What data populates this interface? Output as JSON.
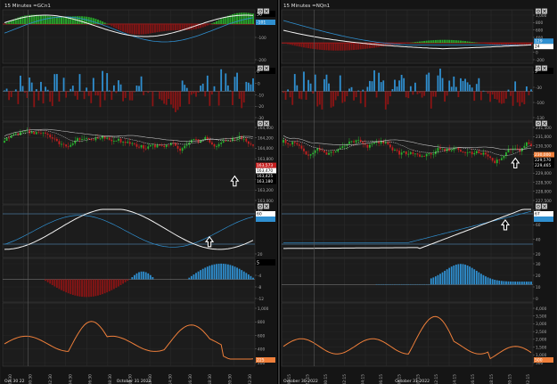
{
  "colors": {
    "bg": "#1c1c1c",
    "grid": "#2c2c2c",
    "up": "#29b32e",
    "down": "#c62020",
    "blue": "#2f8fd0",
    "darkred": "#8b1414",
    "orange": "#ef7f3a",
    "white": "#f2f2f2",
    "sep": "#8a8a8a"
  },
  "left_chart": {
    "title": "15 Minutes =GCn1",
    "panels": [
      {
        "flag": "50",
        "labels": [
          "0",
          "-100",
          "-200"
        ],
        "value_badge": "-101",
        "fills": [
          "hist-top",
          "lines-osc"
        ]
      },
      {
        "flag": "0",
        "labels": [
          "10",
          "0",
          "-10",
          "-20",
          "-30"
        ]
      },
      {
        "flag": "",
        "labels": [
          "164,400",
          "164,200",
          "164,000",
          "163,800",
          "163,600",
          "163,400",
          "163,200",
          "163,000"
        ],
        "price_badges": [
          "163,573",
          "163,470",
          "163,425",
          "163,180"
        ]
      },
      {
        "flag": "",
        "labels": [
          "40",
          "20"
        ],
        "value_badge": "60"
      },
      {
        "flag": "5",
        "labels": [
          "0",
          "-4",
          "-8",
          "-12"
        ]
      },
      {
        "flag": "",
        "labels": [
          "1,000",
          "800",
          "600",
          "400",
          "200"
        ],
        "value_badge": "225"
      }
    ],
    "time_labels": [
      "22:30",
      "00:30",
      "02:30",
      "04:30",
      "06:30",
      "08:30",
      "10:30",
      "12:30",
      "14:30",
      "16:30",
      "18:30",
      "20:30",
      "22:30"
    ],
    "date_left": "Oct 30 22",
    "date_mid": "October 31 2022"
  },
  "right_chart": {
    "title": "15 Minutes =NQn1",
    "panels": [
      {
        "flag": "",
        "labels": [
          "1,000",
          "800",
          "600",
          "400",
          "200",
          "0",
          "-200"
        ],
        "value_badge": "129",
        "value_badge2": "24"
      },
      {
        "flag": "9",
        "labels": [
          "0",
          "-30",
          "-100",
          "-130"
        ]
      },
      {
        "flag": "",
        "labels": [
          "231,500",
          "231,000",
          "230,500",
          "230,000",
          "229,500",
          "229,000",
          "228,500",
          "228,000",
          "227,500"
        ],
        "price_badges": [
          "230,000",
          "229,570",
          "229,465"
        ]
      },
      {
        "flag": "",
        "labels": [
          "80",
          "60",
          "40",
          "20"
        ],
        "value_badge": "67"
      },
      {
        "flag": "",
        "labels": [
          "30",
          "20",
          "10",
          "0"
        ]
      },
      {
        "flag": "",
        "labels": [
          "4,000",
          "3,500",
          "3,000",
          "2,500",
          "2,000",
          "1,500",
          "1,000",
          "500"
        ],
        "value_badge": "500"
      }
    ],
    "time_labels": [
      "20:15",
      "22:15",
      "00:15",
      "02:15",
      "04:15",
      "06:15",
      "08:15",
      "10:15",
      "12:15",
      "14:15",
      "16:15",
      "18:15",
      "20:15",
      "22:15"
    ],
    "date_left": "October 30 2022",
    "date_mid": "October 31 2022"
  },
  "icons": {
    "panel_controls": [
      "settings-icon",
      "close-icon"
    ],
    "annotation_arrow": "up-arrow-icon"
  }
}
